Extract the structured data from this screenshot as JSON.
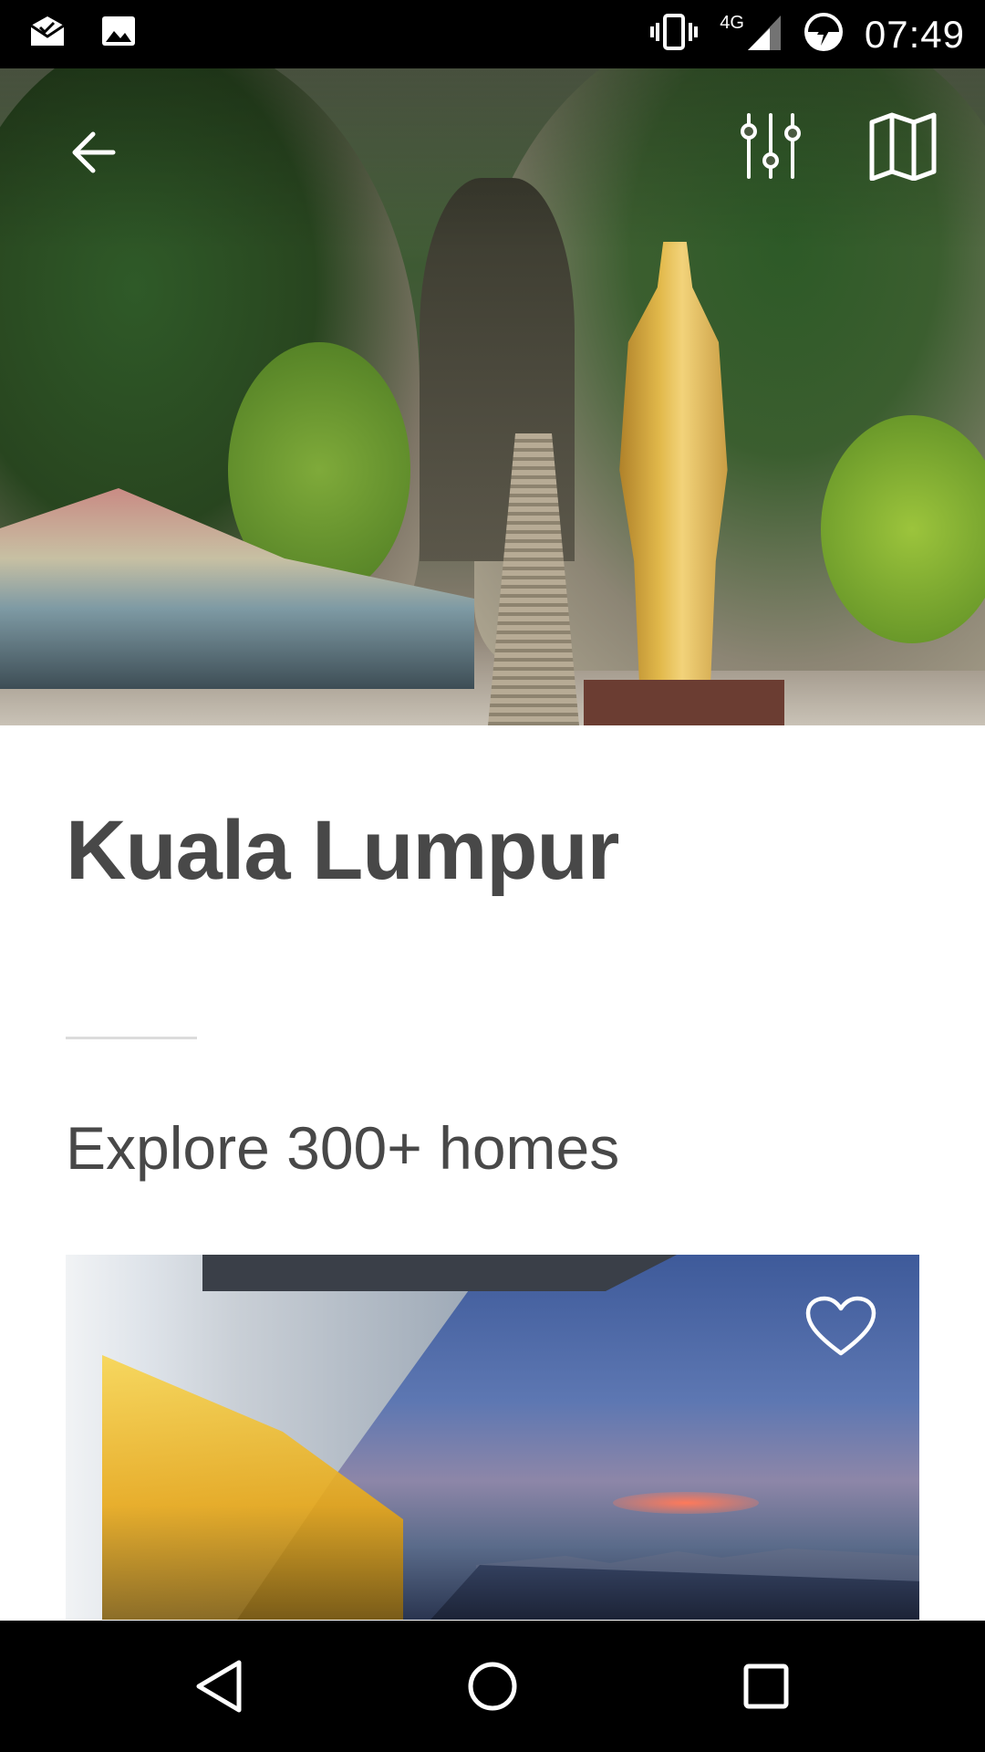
{
  "status_bar": {
    "time": "07:49",
    "network": "4G",
    "left_icons": [
      "mail-check-icon",
      "image-icon"
    ],
    "right_icons": [
      "vibrate-icon",
      "signal-icon",
      "battery-charging-icon"
    ]
  },
  "hero": {
    "actions": [
      "back-arrow-icon",
      "filters-icon",
      "map-icon"
    ]
  },
  "content": {
    "title": "Kuala Lumpur",
    "subtitle": "Explore 300+ homes"
  },
  "listing": {
    "favorite_icon": "heart-outline-icon"
  },
  "nav_bar": {
    "buttons": [
      "back-triangle-icon",
      "home-circle-icon",
      "recents-square-icon"
    ]
  },
  "colors": {
    "text": "#484848",
    "divider": "#dcdcdc",
    "system_bar": "#000000"
  }
}
